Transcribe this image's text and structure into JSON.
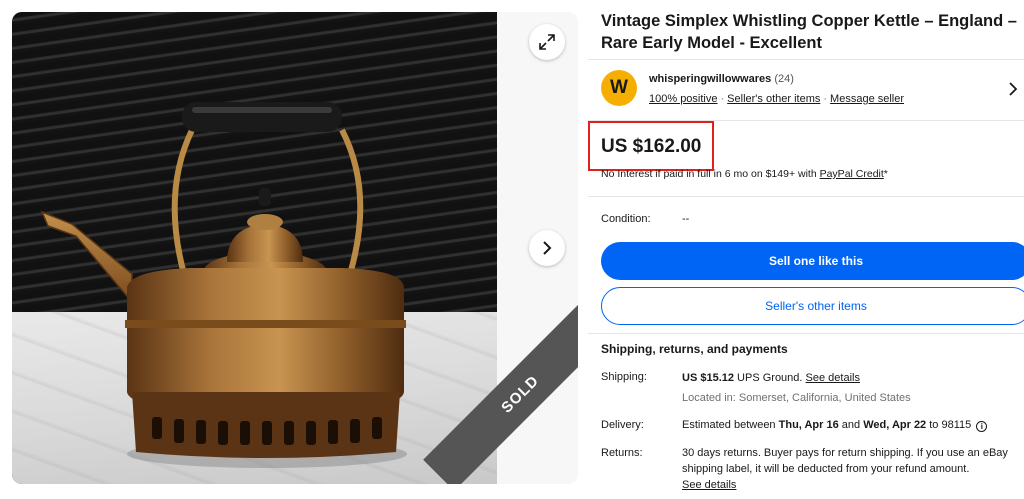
{
  "gallery": {
    "sold_ribbon": "SOLD",
    "expand_icon": "expand-arrows-icon",
    "next_icon": "chevron-right-icon"
  },
  "listing": {
    "title": "Vintage Simplex Whistling Copper Kettle – England – Rare Early Model - Excellent"
  },
  "seller": {
    "avatar_letter": "W",
    "name": "whisperingwillowwares",
    "feedback_count": "(24)",
    "positive": "100% positive",
    "other_items_link": "Seller's other items",
    "message_link": "Message seller"
  },
  "price": {
    "amount": "US $162.00",
    "credit_text": "No Interest if paid in full in 6 mo on $149+ with",
    "credit_link": "PayPal Credit",
    "credit_suffix": "*"
  },
  "condition": {
    "label": "Condition:",
    "value": "--"
  },
  "actions": {
    "primary": "Sell one like this",
    "secondary": "Seller's other items"
  },
  "shipping": {
    "heading": "Shipping, returns, and payments",
    "shipping_label": "Shipping:",
    "shipping_price": "US $15.12",
    "shipping_method": "UPS Ground.",
    "shipping_details_link": "See details",
    "location": "Located in: Somerset, California, United States",
    "delivery_label": "Delivery:",
    "delivery_prefix": "Estimated between",
    "delivery_start": "Thu, Apr 16",
    "delivery_and": "and",
    "delivery_end": "Wed, Apr 22",
    "delivery_to": "to 98115",
    "returns_label": "Returns:",
    "returns_text": "30 days returns. Buyer pays for return shipping. If you use an eBay shipping label, it will be deducted from your refund amount.",
    "returns_link": "See details"
  },
  "colors": {
    "accent_blue": "#0064f5",
    "highlight_red": "#e0201b",
    "avatar_yellow": "#f5af02"
  }
}
